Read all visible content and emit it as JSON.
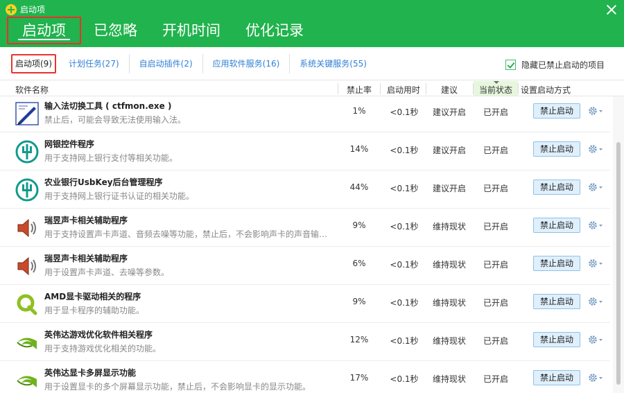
{
  "app": {
    "title": "启动项"
  },
  "main_tabs": [
    {
      "label": "启动项"
    },
    {
      "label": "已忽略"
    },
    {
      "label": "开机时间"
    },
    {
      "label": "优化记录"
    }
  ],
  "sub_tabs": [
    {
      "label": "启动项(9)"
    },
    {
      "label": "计划任务(27)"
    },
    {
      "label": "自启动插件(2)"
    },
    {
      "label": "应用软件服务(16)"
    },
    {
      "label": "系统关键服务(55)"
    }
  ],
  "hide_disabled": {
    "label": "隐藏已禁止启动的项目",
    "checked": true
  },
  "columns": {
    "name": "软件名称",
    "rate": "禁止率",
    "time": "启动用时",
    "advice": "建议",
    "status": "当前状态",
    "action": "设置启动方式"
  },
  "colors": {
    "header_green": "#21b34d",
    "highlight_red": "#e8322a",
    "link_blue": "#2f7fd6"
  },
  "rows": [
    {
      "icon": "pen-icon",
      "name": "输入法切换工具 ( ctfmon.exe )",
      "desc": "禁止后，可能会导致无法使用输入法。",
      "rate": "1%",
      "time": "<0.1秒",
      "advice": "建议开启",
      "status": "已开启",
      "button": "禁止启动"
    },
    {
      "icon": "abc-bank-icon",
      "name": "网银控件程序",
      "desc": "用于支持网上银行支付等相关功能。",
      "rate": "14%",
      "time": "<0.1秒",
      "advice": "建议开启",
      "status": "已开启",
      "button": "禁止启动"
    },
    {
      "icon": "abc-bank-icon",
      "name": "农业银行UsbKey后台管理程序",
      "desc": "用于支持网上银行证书认证的相关功能。",
      "rate": "44%",
      "time": "<0.1秒",
      "advice": "建议开启",
      "status": "已开启",
      "button": "禁止启动"
    },
    {
      "icon": "speaker-icon",
      "name": "瑞昱声卡相关辅助程序",
      "desc": "用于支持设置声卡声道、音频去噪等功能，禁止后，不会影响声卡的声音输出功...",
      "rate": "9%",
      "time": "<0.1秒",
      "advice": "维持现状",
      "status": "已开启",
      "button": "禁止启动"
    },
    {
      "icon": "speaker-icon",
      "name": "瑞昱声卡相关辅助程序",
      "desc": "用于设置声卡声道、去噪等参数。",
      "rate": "6%",
      "time": "<0.1秒",
      "advice": "维持现状",
      "status": "已开启",
      "button": "禁止启动"
    },
    {
      "icon": "amd-q-icon",
      "name": "AMD显卡驱动相关的程序",
      "desc": "用于显卡程序的辅助功能。",
      "rate": "9%",
      "time": "<0.1秒",
      "advice": "维持现状",
      "status": "已开启",
      "button": "禁止启动"
    },
    {
      "icon": "nvidia-icon",
      "name": "英伟达游戏优化软件相关程序",
      "desc": "用于支持游戏优化相关的功能。",
      "rate": "12%",
      "time": "<0.1秒",
      "advice": "维持现状",
      "status": "已开启",
      "button": "禁止启动"
    },
    {
      "icon": "nvidia-icon",
      "name": "英伟达显卡多屏显示功能",
      "desc": "用于设置显卡的多个屏幕显示功能，禁止后，不会影响显卡的显示功能。",
      "rate": "17%",
      "time": "<0.1秒",
      "advice": "维持现状",
      "status": "已开启",
      "button": "禁止启动"
    }
  ]
}
